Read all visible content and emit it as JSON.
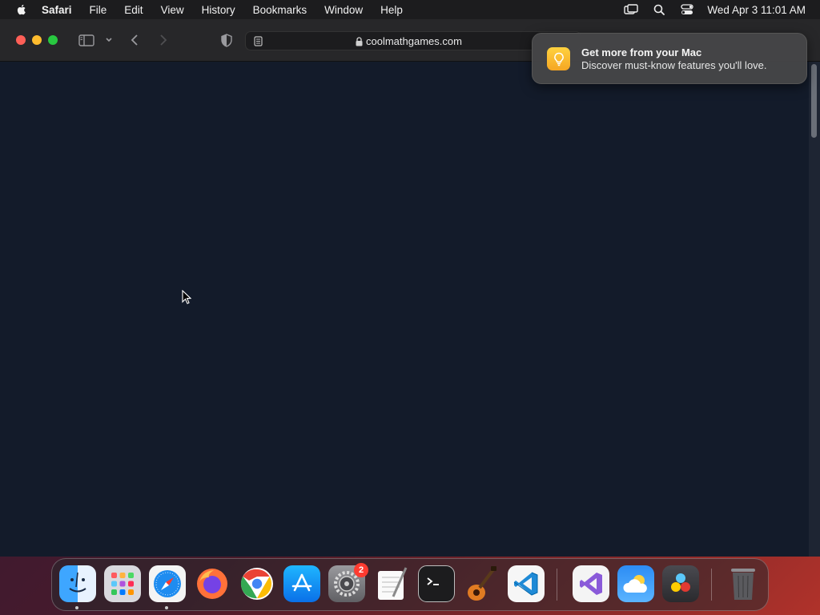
{
  "menubar": {
    "app_name": "Safari",
    "menus": [
      "File",
      "Edit",
      "View",
      "History",
      "Bookmarks",
      "Window",
      "Help"
    ],
    "clock": "Wed Apr 3  11:01 AM",
    "status_icons": [
      "screen-mirroring-icon",
      "spotlight-search-icon",
      "control-center-icon"
    ]
  },
  "browser": {
    "url": "coolmathgames.com"
  },
  "notification": {
    "title": "Get more from your Mac",
    "body": "Discover must-know features you'll love."
  },
  "dock": {
    "apps": [
      "Finder",
      "Launchpad",
      "Safari",
      "Firefox",
      "Chrome",
      "App Store",
      "System Settings",
      "TextEdit",
      "Terminal",
      "GarageBand",
      "Visual Studio Code",
      "Visual Studio",
      "Weather",
      "DaVinci Resolve",
      "Trash"
    ],
    "system_settings_badge": "2"
  },
  "colors": {
    "content_bg": "#131b2a",
    "toolbar_bg": "#272729",
    "close": "#fe5f57",
    "minimize": "#febc2e",
    "maximize": "#28c840"
  }
}
